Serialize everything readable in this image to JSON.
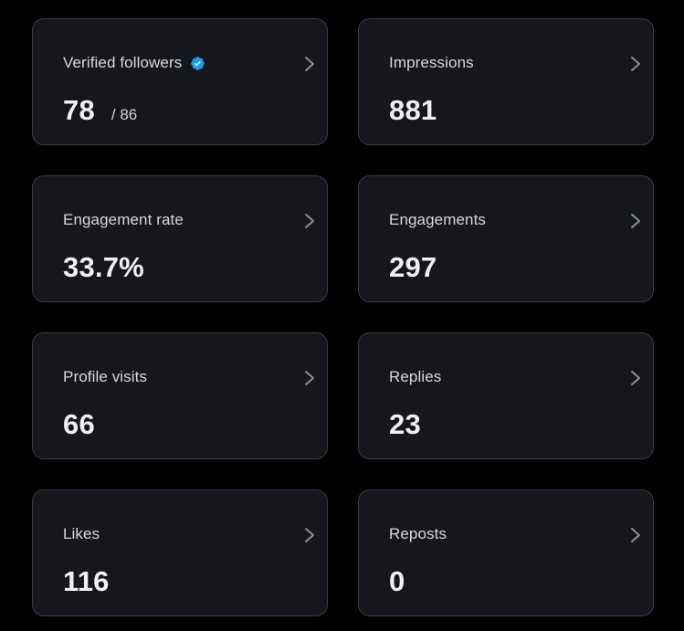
{
  "colors": {
    "background": "#000000",
    "card": "#16171c",
    "border": "#3a3d44",
    "verified": "#1d9bf0"
  },
  "cards": [
    {
      "label": "Verified followers",
      "value": "78",
      "sub": "/ 86",
      "icon": "verified-badge-icon"
    },
    {
      "label": "Impressions",
      "value": "881"
    },
    {
      "label": "Engagement rate",
      "value": "33.7%"
    },
    {
      "label": "Engagements",
      "value": "297"
    },
    {
      "label": "Profile visits",
      "value": "66"
    },
    {
      "label": "Replies",
      "value": "23"
    },
    {
      "label": "Likes",
      "value": "116"
    },
    {
      "label": "Reposts",
      "value": "0"
    }
  ]
}
